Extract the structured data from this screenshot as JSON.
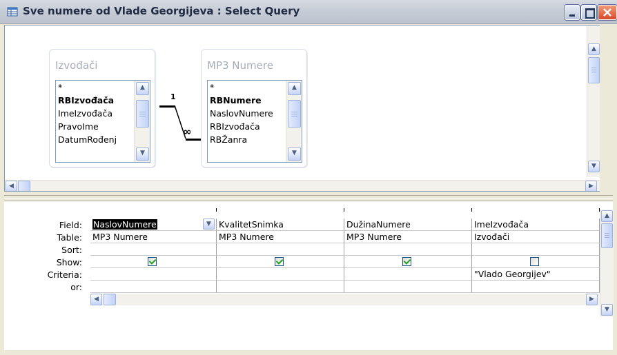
{
  "window": {
    "title": "Sve numere od Vlade Georgijeva : Select Query"
  },
  "tables": [
    {
      "name": "Izvođači",
      "fields": [
        "*",
        "RBIzvođača",
        "ImeIzvođača",
        "PravoIme",
        "DatumRođenj"
      ],
      "primary_key": "RBIzvođača"
    },
    {
      "name": "MP3 Numere",
      "fields": [
        "*",
        "RBNumere",
        "NaslovNumere",
        "RBIzvođača",
        "RBŽanra"
      ],
      "primary_key": "RBNumere"
    }
  ],
  "relationship": {
    "one_side": "1",
    "many_side": "∞"
  },
  "grid": {
    "row_labels": [
      "Field:",
      "Table:",
      "Sort:",
      "Show:",
      "Criteria:",
      "or:"
    ],
    "columns": [
      {
        "field": "NaslovNumere",
        "table": "MP3 Numere",
        "sort": "",
        "show": true,
        "criteria": "",
        "or": ""
      },
      {
        "field": "KvalitetSnimka",
        "table": "MP3 Numere",
        "sort": "",
        "show": true,
        "criteria": "",
        "or": ""
      },
      {
        "field": "DužinaNumere",
        "table": "MP3 Numere",
        "sort": "",
        "show": true,
        "criteria": "",
        "or": ""
      },
      {
        "field": "ImeIzvođača",
        "table": "Izvođači",
        "sort": "",
        "show": false,
        "criteria": "\"Vlado Georgijev\"",
        "or": ""
      }
    ]
  },
  "colors": {
    "selection": "#000000",
    "checkmark": "#21a121",
    "border": "#7f9db9"
  }
}
